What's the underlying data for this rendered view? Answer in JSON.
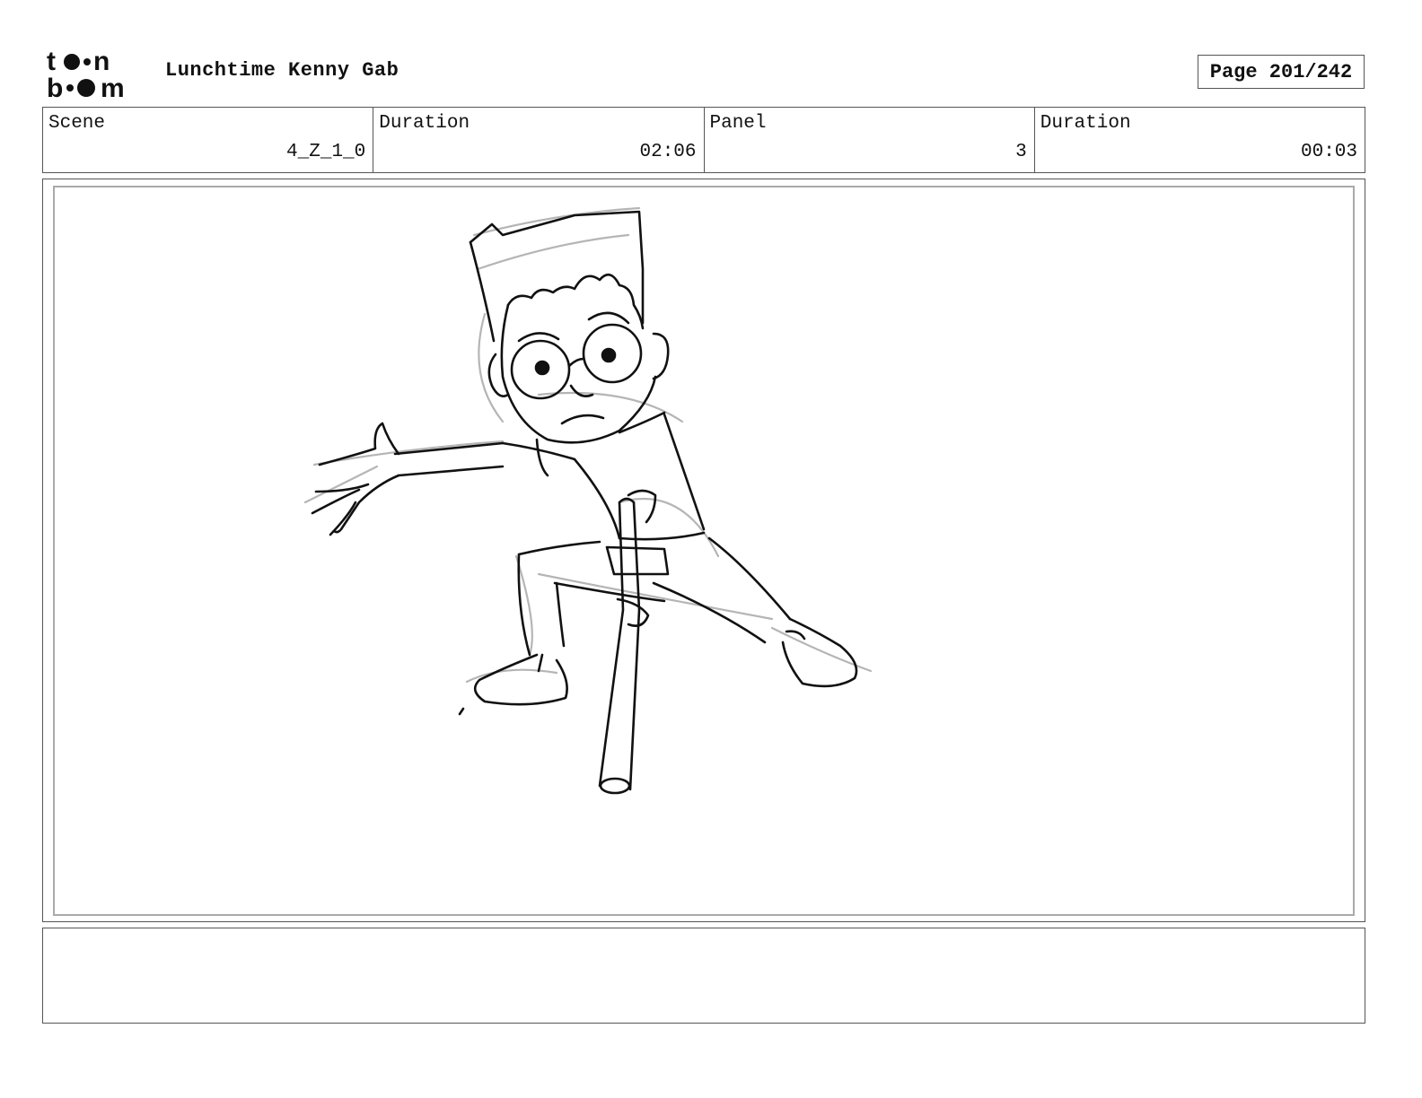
{
  "header": {
    "logo_text": "toon boom",
    "project_title": "Lunchtime Kenny Gab",
    "page_label": "Page 201/242"
  },
  "info": {
    "scene_label": "Scene",
    "scene_value": "4_Z_1_0",
    "scene_duration_label": "Duration",
    "scene_duration_value": "02:06",
    "panel_label": "Panel",
    "panel_value": "3",
    "panel_duration_label": "Duration",
    "panel_duration_value": "00:03"
  },
  "notes": {
    "text": ""
  },
  "colors": {
    "ink": "#111111",
    "rough": "#b0b0b0",
    "frame": "#555555"
  }
}
